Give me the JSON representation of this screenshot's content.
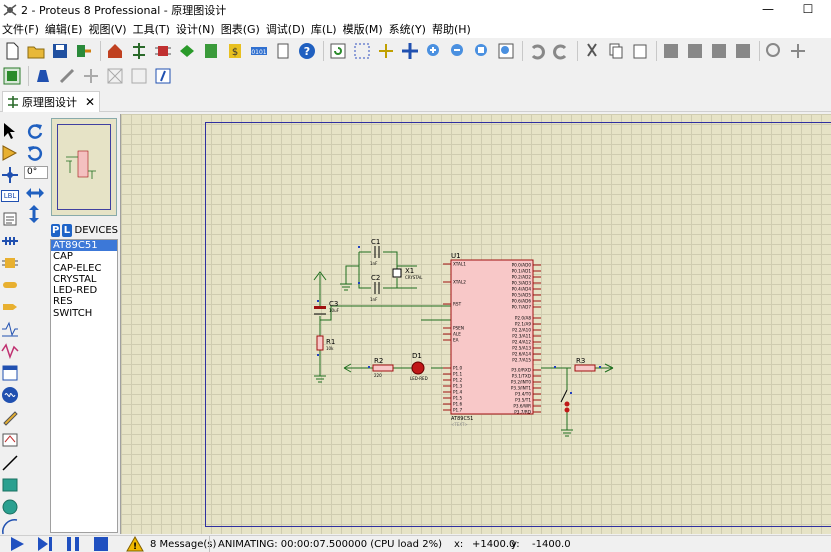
{
  "window": {
    "title": "2 - Proteus 8 Professional - 原理图设计",
    "minimize": "—",
    "maximize": "☐"
  },
  "menu": [
    "文件(F)",
    "编辑(E)",
    "视图(V)",
    "工具(T)",
    "设计(N)",
    "图表(G)",
    "调试(D)",
    "库(L)",
    "模版(M)",
    "系统(Y)",
    "帮助(H)"
  ],
  "tab": {
    "label": "原理图设计",
    "close": "✕"
  },
  "rotation": {
    "angle": "0°"
  },
  "device_panel": {
    "p_button": "P",
    "l_button": "L",
    "header": "DEVICES",
    "items": [
      "AT89C51",
      "CAP",
      "CAP-ELEC",
      "CRYSTAL",
      "LED-RED",
      "RES",
      "SWITCH"
    ],
    "selected_index": 0
  },
  "lefttool_labels": {
    "lbl": "LBL"
  },
  "schematic": {
    "u1": {
      "ref": "U1",
      "part": "AT89C51",
      "text": "<TEXT>",
      "left_pins": [
        "XTAL1",
        "XTAL2",
        "RST",
        "PSEN",
        "ALE",
        "EA",
        "P1.0",
        "P1.1",
        "P1.2",
        "P1.3",
        "P1.4",
        "P1.5",
        "P1.6",
        "P1.7"
      ],
      "right_pins": [
        "P0.0/AD0",
        "P0.1/AD1",
        "P0.2/AD2",
        "P0.3/AD3",
        "P0.4/AD4",
        "P0.5/AD5",
        "P0.6/AD6",
        "P0.7/AD7",
        "P2.0/A8",
        "P2.1/A9",
        "P2.2/A10",
        "P2.3/A11",
        "P2.4/A12",
        "P2.5/A13",
        "P2.6/A14",
        "P2.7/A15",
        "P3.0/RXD",
        "P3.1/TXD",
        "P3.2/INT0",
        "P3.3/INT1",
        "P3.4/T0",
        "P3.5/T1",
        "P3.6/WR",
        "P3.7/RD"
      ]
    },
    "c1": {
      "ref": "C1",
      "value": "1nF"
    },
    "c2": {
      "ref": "C2",
      "value": "1nF"
    },
    "x1": {
      "ref": "X1",
      "value": "CRYSTAL"
    },
    "c3": {
      "ref": "C3",
      "value": "10uF"
    },
    "r1": {
      "ref": "R1",
      "value": "10k"
    },
    "r2": {
      "ref": "R2",
      "value": "220"
    },
    "d1": {
      "ref": "D1",
      "value": "LED-RED"
    },
    "r3": {
      "ref": "R3",
      "value": "<TEXT>"
    },
    "placeholder": "<TEXT>"
  },
  "status": {
    "messages": "8 Message(s)",
    "animating": "ANIMATING: 00:00:07.500000 (CPU load 2%)",
    "x_label": "x:",
    "x_value": "+1400.0",
    "y_label": "y:",
    "y_value": "-1400.0"
  },
  "colors": {
    "canvas": "#e6e3c6",
    "wire": "#1e6e1e",
    "chip": "#f8c8c8",
    "chip_border": "#a01010",
    "sheet": "#3030a0"
  }
}
